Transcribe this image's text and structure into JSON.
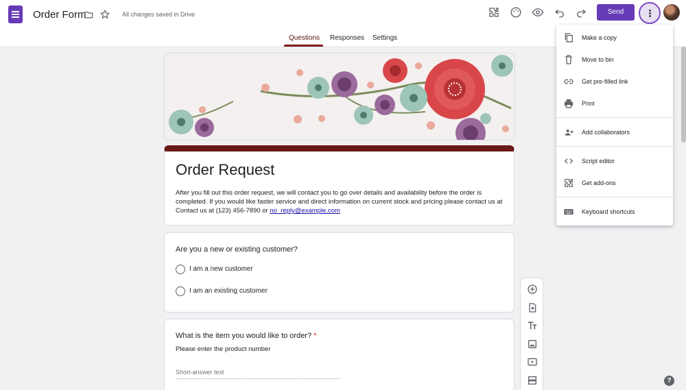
{
  "app": {
    "doc_title": "Order Form",
    "saved_status": "All changes saved in Drive",
    "send_label": "Send",
    "help_glyph": "?"
  },
  "tabs": [
    {
      "label": "Questions",
      "active": true
    },
    {
      "label": "Responses",
      "active": false
    },
    {
      "label": "Settings",
      "active": false
    }
  ],
  "form": {
    "title": "Order Request",
    "description_text": "After you fill out this order request, we will contact you to go over details and availability before the order is completed. If you would like faster service and direct information on current stock and pricing please contact us at Contact us at (123) 456-7890 or ",
    "description_link": "no_reply@example.com"
  },
  "questions": [
    {
      "title": "Are you a new or existing customer?",
      "options": [
        "I am a new customer",
        "I am an existing customer"
      ]
    },
    {
      "title": "What is the item you would like to order?",
      "required_mark": "*",
      "description": "Please enter the product number",
      "placeholder": "Short-answer text"
    }
  ],
  "menu": {
    "items": [
      {
        "label": "Make a copy",
        "icon": "copy-icon"
      },
      {
        "label": "Move to bin",
        "icon": "trash-icon"
      },
      {
        "label": "Get pre-filled link",
        "icon": "link-icon"
      },
      {
        "label": "Print",
        "icon": "print-icon"
      },
      {
        "label": "Add collaborators",
        "icon": "add-people-icon"
      },
      {
        "label": "Script editor",
        "icon": "code-icon"
      },
      {
        "label": "Get add-ons",
        "icon": "puzzle-icon"
      },
      {
        "label": "Keyboard shortcuts",
        "icon": "keyboard-icon"
      }
    ]
  },
  "colors": {
    "accent": "#673ab7",
    "theme": "#6b1818"
  }
}
